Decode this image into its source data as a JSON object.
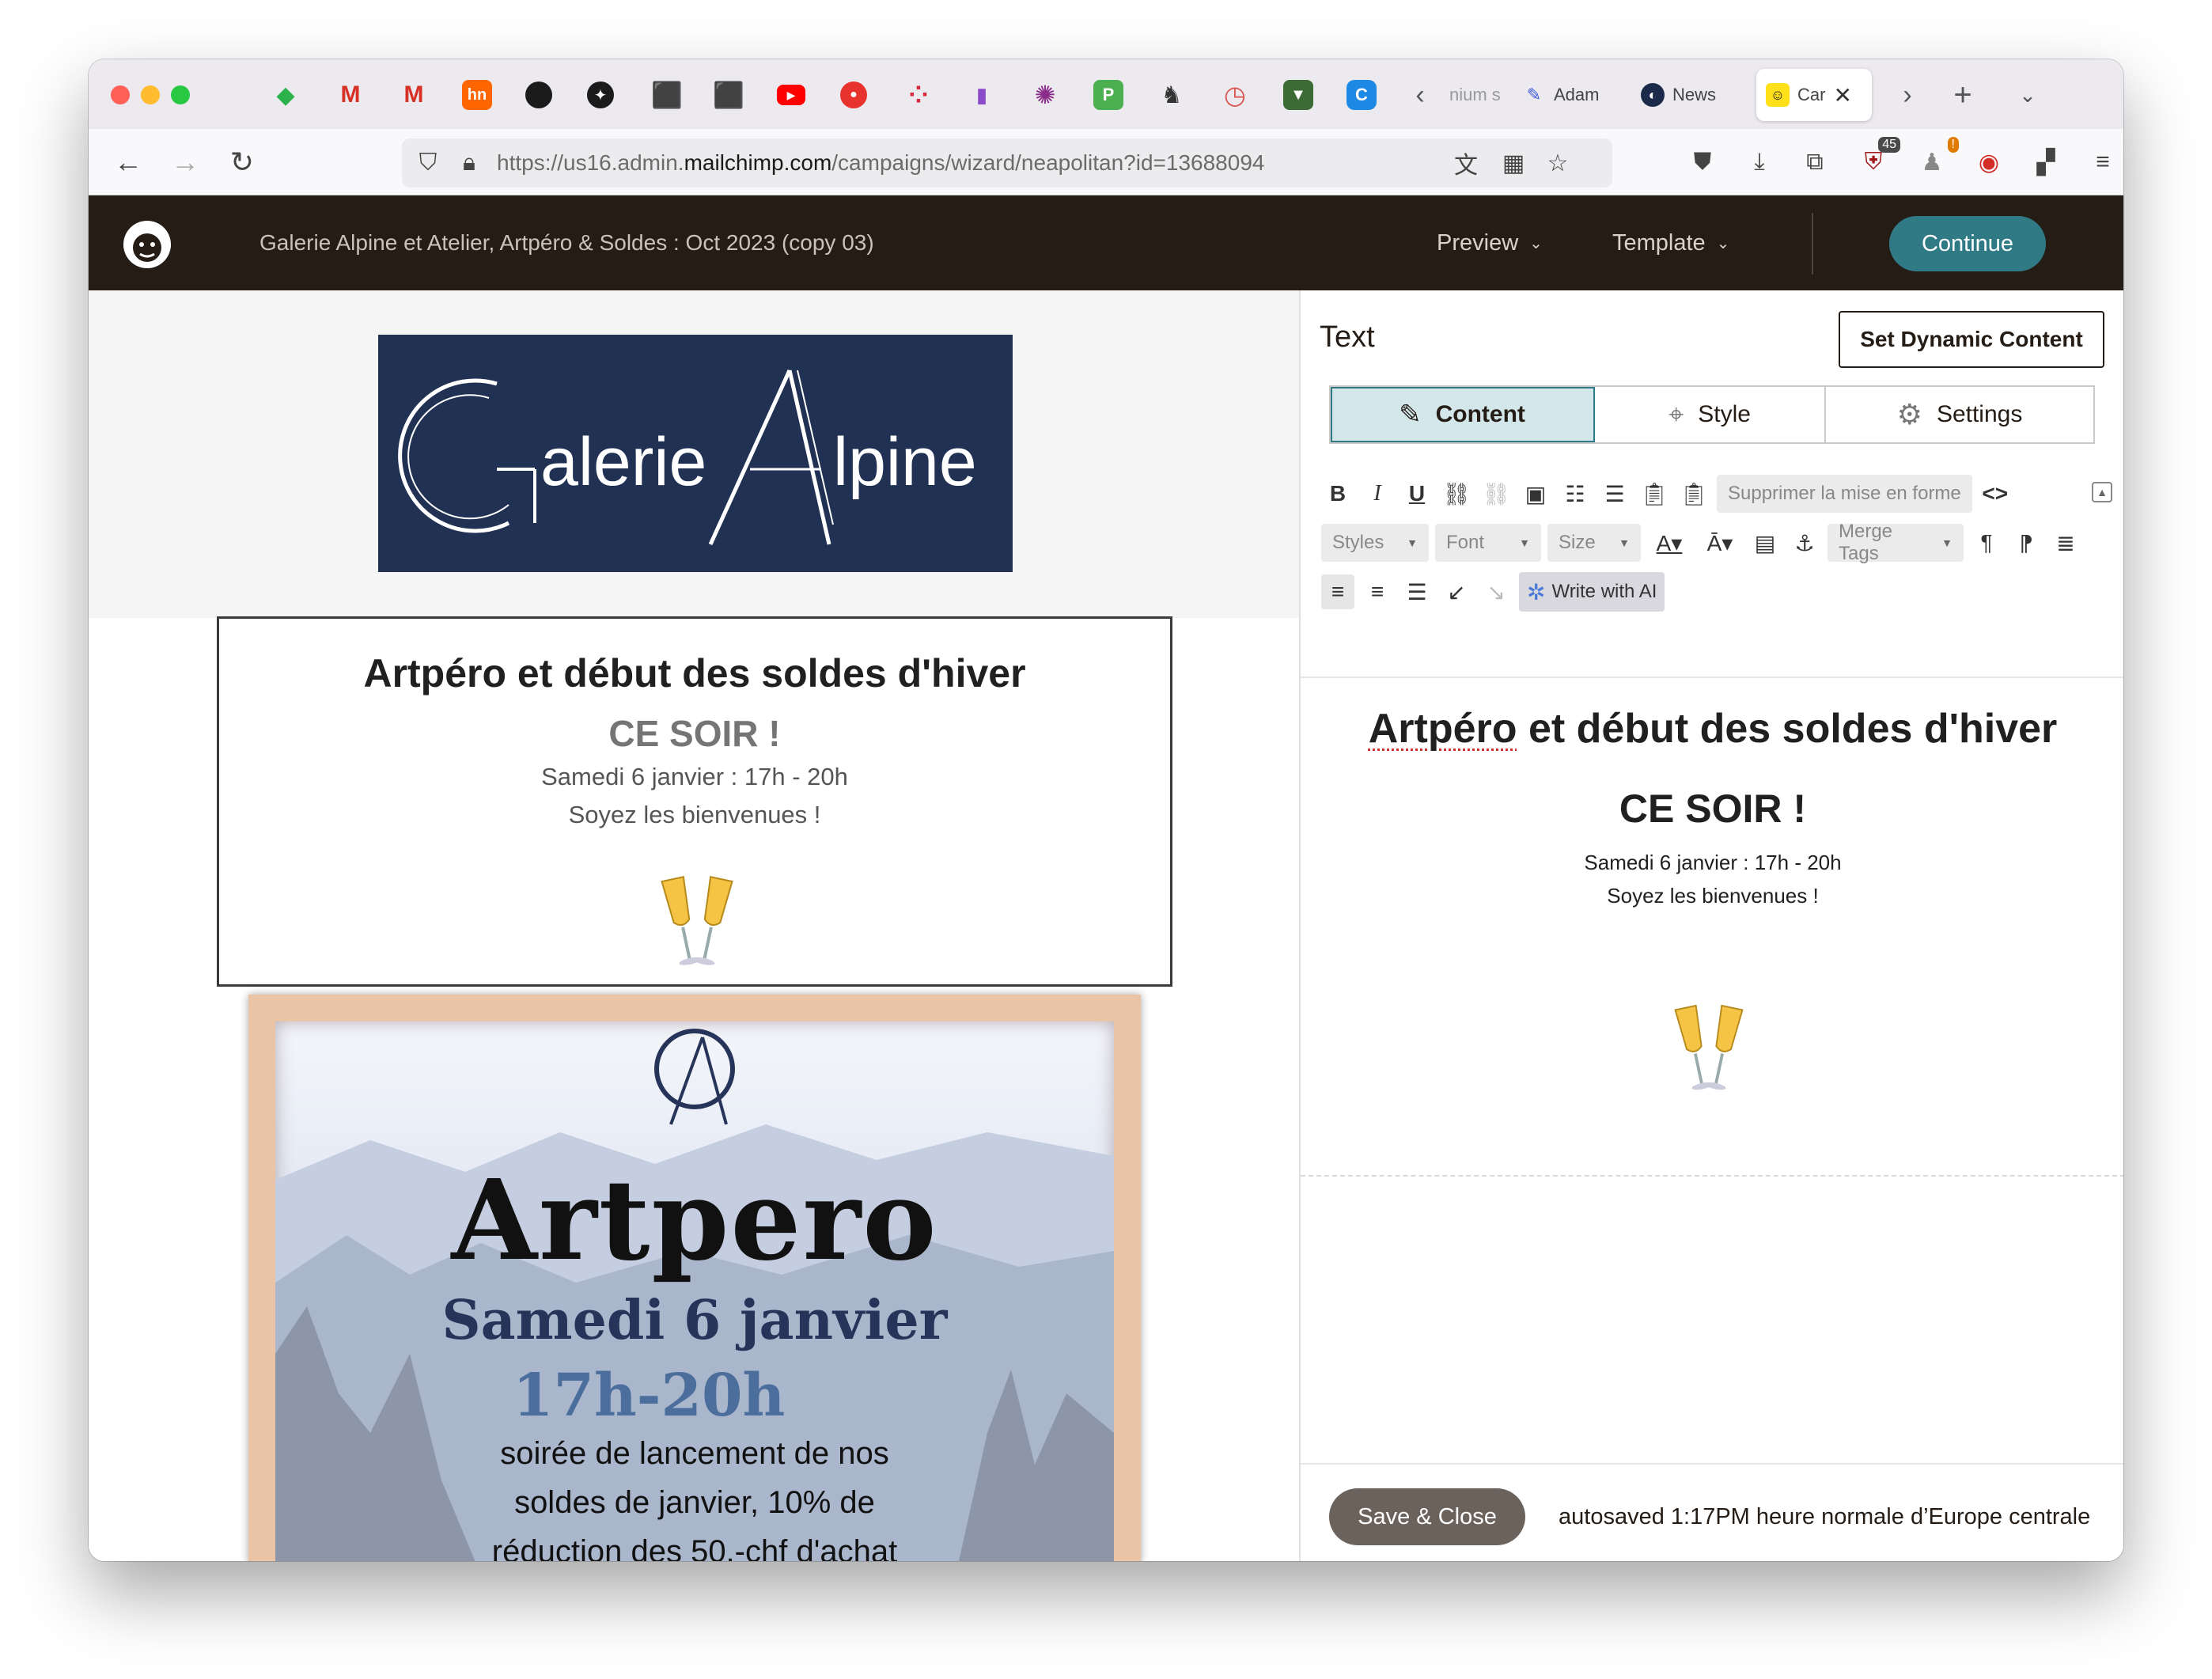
{
  "browser": {
    "tabs": [
      {
        "label": "nium s",
        "icon": "globe-icon"
      },
      {
        "label": "Adam",
        "icon": "adam-icon"
      },
      {
        "label": "News",
        "icon": "news-icon"
      },
      {
        "label": "Car",
        "icon": "mailchimp-icon"
      }
    ],
    "url": {
      "prefix": "https://us16.admin.",
      "domain": "mailchimp.com",
      "path": "/campaigns/wizard/neapolitan?id=13688094"
    },
    "extension_badges": {
      "ublock": "45",
      "alert": "!"
    },
    "pinned_icons": [
      "feedly-icon",
      "gmail-icon",
      "gmail-icon",
      "hn-icon",
      "github-icon",
      "openai-icon",
      "cube-icon",
      "cube-icon",
      "youtube-icon",
      "target-icon",
      "dots-icon",
      "shop-icon",
      "gear-icon",
      "p-icon",
      "camel-icon",
      "clock-icon",
      "shield-icon",
      "c-icon"
    ],
    "hn_label": "hn",
    "p_label": "P",
    "c_label": "C"
  },
  "mailchimp": {
    "campaign_title": "Galerie Alpine et Atelier, Artpéro & Soldes : Oct 2023 (copy 03)",
    "preview_label": "Preview",
    "template_label": "Template",
    "continue_label": "Continue"
  },
  "preview": {
    "logo_text": "Galerie Alpine",
    "heading": "Artpéro et début des soldes d'hiver",
    "ce_soir": "CE SOIR !",
    "date": "Samedi 6 janvier : 17h - 20h",
    "welcome": "Soyez les bienvenues !",
    "poster": {
      "title": "Artpero",
      "date": "Samedi 6 janvier",
      "time": "17h-20h",
      "lines": [
        "soirée de lancement de nos",
        "soldes de janvier, 10% de",
        "réduction des 50.-chf d'achat"
      ]
    }
  },
  "editor": {
    "title": "Text",
    "dynamic_button": "Set Dynamic Content",
    "tabs": [
      {
        "label": "Content",
        "icon": "pencil-icon",
        "active": true
      },
      {
        "label": "Style",
        "icon": "brush-icon",
        "active": false
      },
      {
        "label": "Settings",
        "icon": "gear-icon",
        "active": false
      }
    ],
    "toolbar": {
      "bold": "B",
      "italic": "I",
      "underline": "U",
      "clear_format": "Supprimer la mise en forme",
      "code": "<>",
      "styles": "Styles",
      "font": "Font",
      "size": "Size",
      "merge_tags": "Merge Tags",
      "write_ai": "Write with AI"
    },
    "content": {
      "heading_spell": "Artpéro",
      "heading_rest": " et début des soldes d'hiver",
      "ce_soir": "CE SOIR !",
      "date": "Samedi 6 janvier : 17h - 20h",
      "welcome": "Soyez les bienvenues !"
    },
    "save_close": "Save & Close",
    "autosave": "autosaved 1:17PM heure normale d’Europe centrale"
  },
  "colors": {
    "mc_bar": "#241c15",
    "continue": "#2f7a85",
    "active_tab": "#d3e6ea",
    "logo_bg": "#213153"
  }
}
